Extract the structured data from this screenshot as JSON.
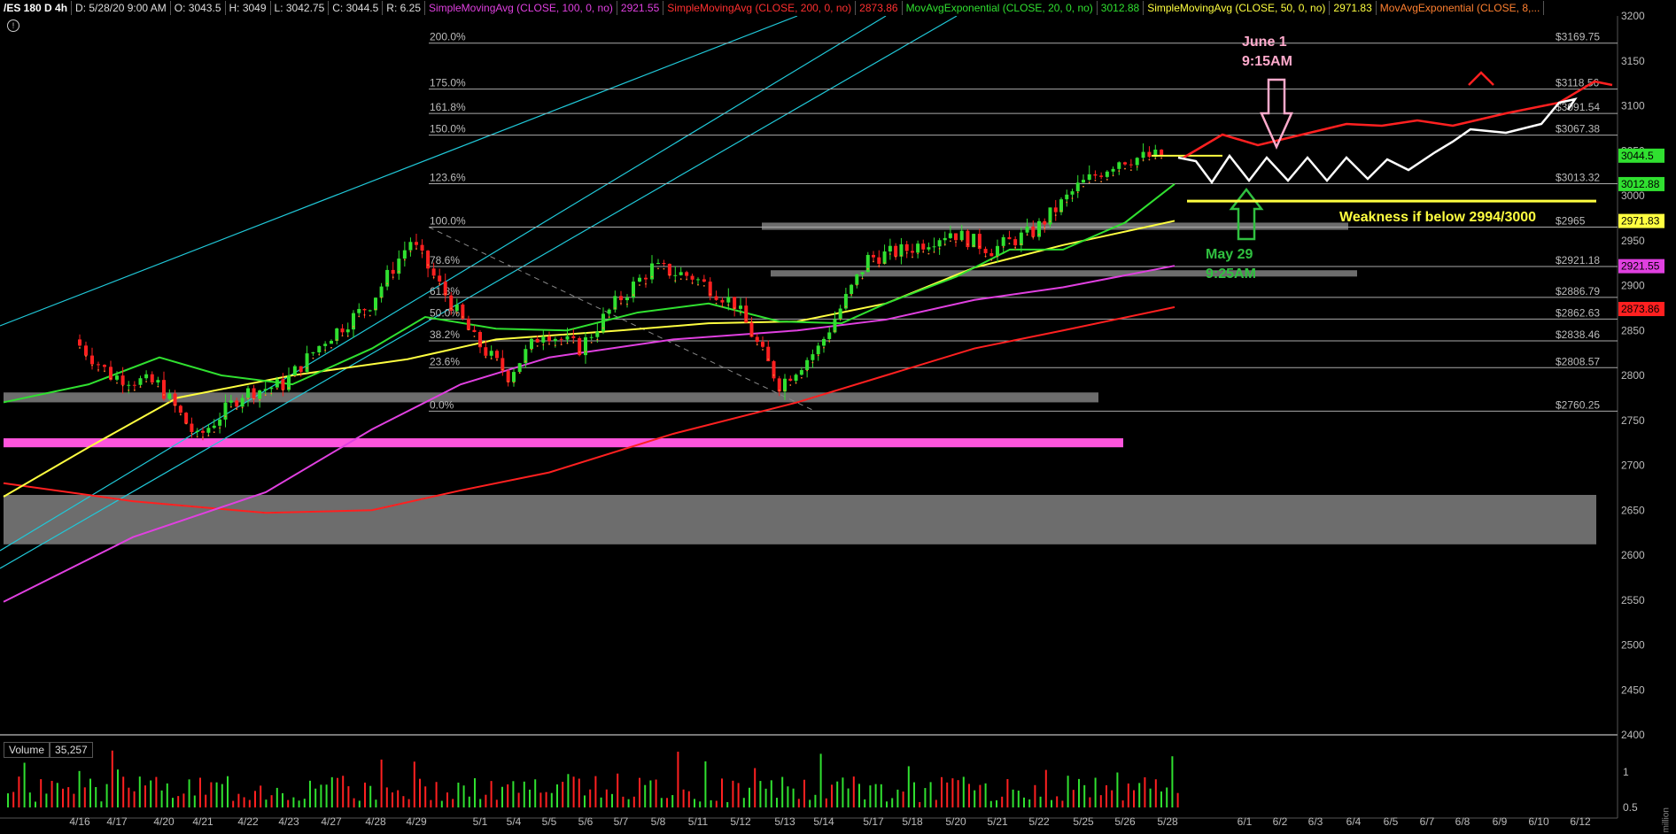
{
  "header": {
    "symbol": "/ES 180 D 4h",
    "date": "D: 5/28/20 9:00 AM",
    "open": "O: 3043.5",
    "high": "H: 3049",
    "low": "L: 3042.75",
    "close": "C: 3044.5",
    "range": "R: 6.25",
    "studies": [
      {
        "label": "SimpleMovingAvg (CLOSE, 100, 0, no)",
        "value": "2921.55",
        "color": "#e040e0"
      },
      {
        "label": "SimpleMovingAvg (CLOSE, 200, 0, no)",
        "value": "2873.86",
        "color": "#ff3030"
      },
      {
        "label": "MovAvgExponential (CLOSE, 20, 0, no)",
        "value": "3012.88",
        "color": "#30e030"
      },
      {
        "label": "SimpleMovingAvg (CLOSE, 50, 0, no)",
        "value": "2971.83",
        "color": "#ffff40"
      },
      {
        "label": "MovAvgExponential (CLOSE, 8,...",
        "value": "",
        "color": "#ff8030"
      }
    ]
  },
  "volume_label": {
    "title": "Volume",
    "value": "35,257"
  },
  "colors": {
    "up": "#30e030",
    "down": "#ff2020",
    "grid": "#333333",
    "fib": "#aaaaaa",
    "zone": "#808080",
    "pink_zone": "#ff55dd",
    "channel": "#20c8d8",
    "ema20": "#30e030",
    "sma50": "#ffff40",
    "sma100": "#e040e0",
    "sma200": "#ff2020",
    "ema8": "#ff8030"
  },
  "chart_data": {
    "type": "candlestick",
    "title": "/ES 180 D 4h",
    "y_axis": {
      "range": [
        2400,
        3200
      ],
      "ticks": [
        3200,
        3150,
        3100,
        3050,
        3000,
        2950,
        2900,
        2850,
        2800,
        2750,
        2700,
        2650,
        2600,
        2550,
        2500,
        2450,
        2400
      ]
    },
    "x_axis": {
      "labels": [
        "4/16",
        "4/17",
        "4/20",
        "4/21",
        "4/22",
        "4/23",
        "4/27",
        "4/28",
        "4/29",
        "5/1",
        "5/4",
        "5/5",
        "5/6",
        "5/7",
        "5/8",
        "5/11",
        "5/12",
        "5/13",
        "5/14",
        "5/17",
        "5/18",
        "5/20",
        "5/21",
        "5/22",
        "5/25",
        "5/26",
        "5/28",
        "6/1",
        "6/2",
        "6/3",
        "6/4",
        "6/5",
        "6/7",
        "6/8",
        "6/9",
        "6/10",
        "6/12"
      ]
    },
    "price_path": [
      [
        "4/16",
        2840
      ],
      [
        "4/17",
        2800
      ],
      [
        "4/20",
        2790
      ],
      [
        "4/21",
        2730
      ],
      [
        "4/22",
        2780
      ],
      [
        "4/23",
        2790
      ],
      [
        "4/27",
        2840
      ],
      [
        "4/28",
        2880
      ],
      [
        "4/29",
        2950
      ],
      [
        "5/1",
        2840
      ],
      [
        "5/4",
        2800
      ],
      [
        "5/5",
        2850
      ],
      [
        "5/6",
        2830
      ],
      [
        "5/7",
        2880
      ],
      [
        "5/8",
        2920
      ],
      [
        "5/11",
        2910
      ],
      [
        "5/12",
        2880
      ],
      [
        "5/13",
        2790
      ],
      [
        "5/14",
        2830
      ],
      [
        "5/17",
        2930
      ],
      [
        "5/18",
        2940
      ],
      [
        "5/20",
        2960
      ],
      [
        "5/21",
        2940
      ],
      [
        "5/22",
        2960
      ],
      [
        "5/25",
        3010
      ],
      [
        "5/26",
        3040
      ],
      [
        "5/28",
        3044.5
      ]
    ],
    "fib_levels": [
      {
        "label": "200.0%",
        "price": 3169.75,
        "price_label": "$3169.75"
      },
      {
        "label": "175.0%",
        "price": 3118.56,
        "price_label": "$3118.56"
      },
      {
        "label": "161.8%",
        "price": 3091.54,
        "price_label": "$3091.54"
      },
      {
        "label": "150.0%",
        "price": 3067.38,
        "price_label": "$3067.38"
      },
      {
        "label": "123.6%",
        "price": 3013.32,
        "price_label": "$3013.32"
      },
      {
        "label": "100.0%",
        "price": 2965,
        "price_label": "$2965"
      },
      {
        "label": "78.6%",
        "price": 2921.18,
        "price_label": "$2921.18"
      },
      {
        "label": "61.8%",
        "price": 2886.79,
        "price_label": "$2886.79"
      },
      {
        "label": "50.0%",
        "price": 2862.63,
        "price_label": "$2862.63"
      },
      {
        "label": "38.2%",
        "price": 2838.46,
        "price_label": "$2838.46"
      },
      {
        "label": "23.6%",
        "price": 2808.57,
        "price_label": "$2808.57"
      },
      {
        "label": "0.0%",
        "price": 2760.25,
        "price_label": "$2760.25"
      }
    ],
    "price_badges": [
      {
        "value": "3044.5",
        "price": 3044.5,
        "color": "#30e030"
      },
      {
        "value": "3012.88",
        "price": 3012.88,
        "color": "#30e030"
      },
      {
        "value": "2971.83",
        "price": 2971.83,
        "color": "#ffff40"
      },
      {
        "value": "2921.55",
        "price": 2921.55,
        "color": "#e040e0"
      },
      {
        "value": "2873.86",
        "price": 2873.86,
        "color": "#ff2020"
      }
    ],
    "zones": [
      {
        "from": "4/29",
        "to": "6/2",
        "low": 2962,
        "high": 2970
      },
      {
        "from": "5/13",
        "to": "6/2",
        "low": 2910,
        "high": 2917
      },
      {
        "from": "4/16",
        "to": "5/13",
        "low": 2770,
        "high": 2781
      },
      {
        "from": "4/16",
        "to": "5/14",
        "low": 2720,
        "high": 2730,
        "pink": true
      },
      {
        "from": "4/16",
        "to": "6/10",
        "low": 2612,
        "high": 2667
      }
    ],
    "annotations": [
      {
        "text": "June 1",
        "color": "#ffaacc"
      },
      {
        "text": "9:15AM",
        "color": "#ffaacc"
      },
      {
        "text": "May 29",
        "color": "#30c040"
      },
      {
        "text": "9:25AM",
        "color": "#30c040"
      },
      {
        "text": "Weakness if below 2994/3000",
        "color": "#ffff40"
      }
    ],
    "volume_axis": {
      "ticks": [
        "1",
        "0.5"
      ],
      "unit": "million"
    }
  }
}
